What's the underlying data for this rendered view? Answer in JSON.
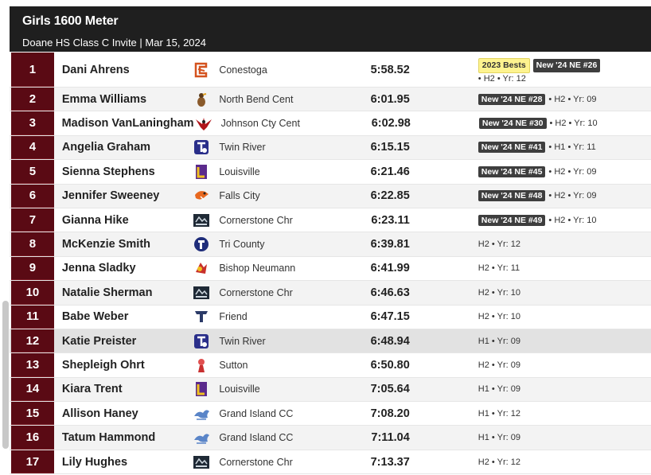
{
  "header": {
    "title": "Girls 1600 Meter",
    "subtitle": "Doane HS Class C Invite | Mar 15, 2024"
  },
  "results": [
    {
      "place": "1",
      "name": "Dani Ahrens",
      "school": "Conestoga",
      "logo": "conestoga-logo-icon",
      "mark": "5:58.52",
      "best": "2023 Bests",
      "ne": "New '24 NE #26",
      "info": "• H2 • Yr: 12"
    },
    {
      "place": "2",
      "name": "Emma Williams",
      "school": "North Bend Cent",
      "logo": "north-bend-logo-icon",
      "mark": "6:01.95",
      "best": "",
      "ne": "New '24 NE #28",
      "info": "• H2 • Yr: 09"
    },
    {
      "place": "3",
      "name": "Madison VanLaningham",
      "school": "Johnson Cty Cent",
      "logo": "johnson-county-logo-icon",
      "mark": "6:02.98",
      "best": "",
      "ne": "New '24 NE #30",
      "info": "• H2 • Yr: 10"
    },
    {
      "place": "4",
      "name": "Angelia Graham",
      "school": "Twin River",
      "logo": "twin-river-logo-icon",
      "mark": "6:15.15",
      "best": "",
      "ne": "New '24 NE #41",
      "info": "• H1 • Yr: 11"
    },
    {
      "place": "5",
      "name": "Sienna Stephens",
      "school": "Louisville",
      "logo": "louisville-logo-icon",
      "mark": "6:21.46",
      "best": "",
      "ne": "New '24 NE #45",
      "info": "• H2 • Yr: 09"
    },
    {
      "place": "6",
      "name": "Jennifer Sweeney",
      "school": "Falls City",
      "logo": "falls-city-logo-icon",
      "mark": "6:22.85",
      "best": "",
      "ne": "New '24 NE #48",
      "info": "• H2 • Yr: 09"
    },
    {
      "place": "7",
      "name": "Gianna Hike",
      "school": "Cornerstone Chr",
      "logo": "cornerstone-logo-icon",
      "mark": "6:23.11",
      "best": "",
      "ne": "New '24 NE #49",
      "info": "• H2 • Yr: 10"
    },
    {
      "place": "8",
      "name": "McKenzie Smith",
      "school": "Tri County",
      "logo": "tri-county-logo-icon",
      "mark": "6:39.81",
      "best": "",
      "ne": "",
      "info": "H2 • Yr: 12"
    },
    {
      "place": "9",
      "name": "Jenna Sladky",
      "school": "Bishop Neumann",
      "logo": "bishop-neumann-logo-icon",
      "mark": "6:41.99",
      "best": "",
      "ne": "",
      "info": "H2 • Yr: 11"
    },
    {
      "place": "10",
      "name": "Natalie Sherman",
      "school": "Cornerstone Chr",
      "logo": "cornerstone-logo-icon",
      "mark": "6:46.63",
      "best": "",
      "ne": "",
      "info": "H2 • Yr: 10"
    },
    {
      "place": "11",
      "name": "Babe Weber",
      "school": "Friend",
      "logo": "friend-logo-icon",
      "mark": "6:47.15",
      "best": "",
      "ne": "",
      "info": "H2 • Yr: 10"
    },
    {
      "place": "12",
      "name": "Katie Preister",
      "school": "Twin River",
      "logo": "twin-river-logo-icon",
      "mark": "6:48.94",
      "best": "",
      "ne": "",
      "info": "H1 • Yr: 09"
    },
    {
      "place": "13",
      "name": "Shepleigh Ohrt",
      "school": "Sutton",
      "logo": "sutton-logo-icon",
      "mark": "6:50.80",
      "best": "",
      "ne": "",
      "info": "H2 • Yr: 09"
    },
    {
      "place": "14",
      "name": "Kiara Trent",
      "school": "Louisville",
      "logo": "louisville-logo-icon",
      "mark": "7:05.64",
      "best": "",
      "ne": "",
      "info": "H1 • Yr: 09"
    },
    {
      "place": "15",
      "name": "Allison Haney",
      "school": "Grand Island CC",
      "logo": "grand-island-cc-logo-icon",
      "mark": "7:08.20",
      "best": "",
      "ne": "",
      "info": "H1 • Yr: 12"
    },
    {
      "place": "16",
      "name": "Tatum Hammond",
      "school": "Grand Island CC",
      "logo": "grand-island-cc-logo-icon",
      "mark": "7:11.04",
      "best": "",
      "ne": "",
      "info": "H1 • Yr: 09"
    },
    {
      "place": "17",
      "name": "Lily Hughes",
      "school": "Cornerstone Chr",
      "logo": "cornerstone-logo-icon",
      "mark": "7:13.37",
      "best": "",
      "ne": "",
      "info": "H2 • Yr: 12"
    }
  ],
  "colors": {
    "header_bg": "#1f1f1f",
    "place_bg": "#5a0a14",
    "best_badge": "#fdf38f",
    "ne_badge": "#3e3e3e"
  }
}
